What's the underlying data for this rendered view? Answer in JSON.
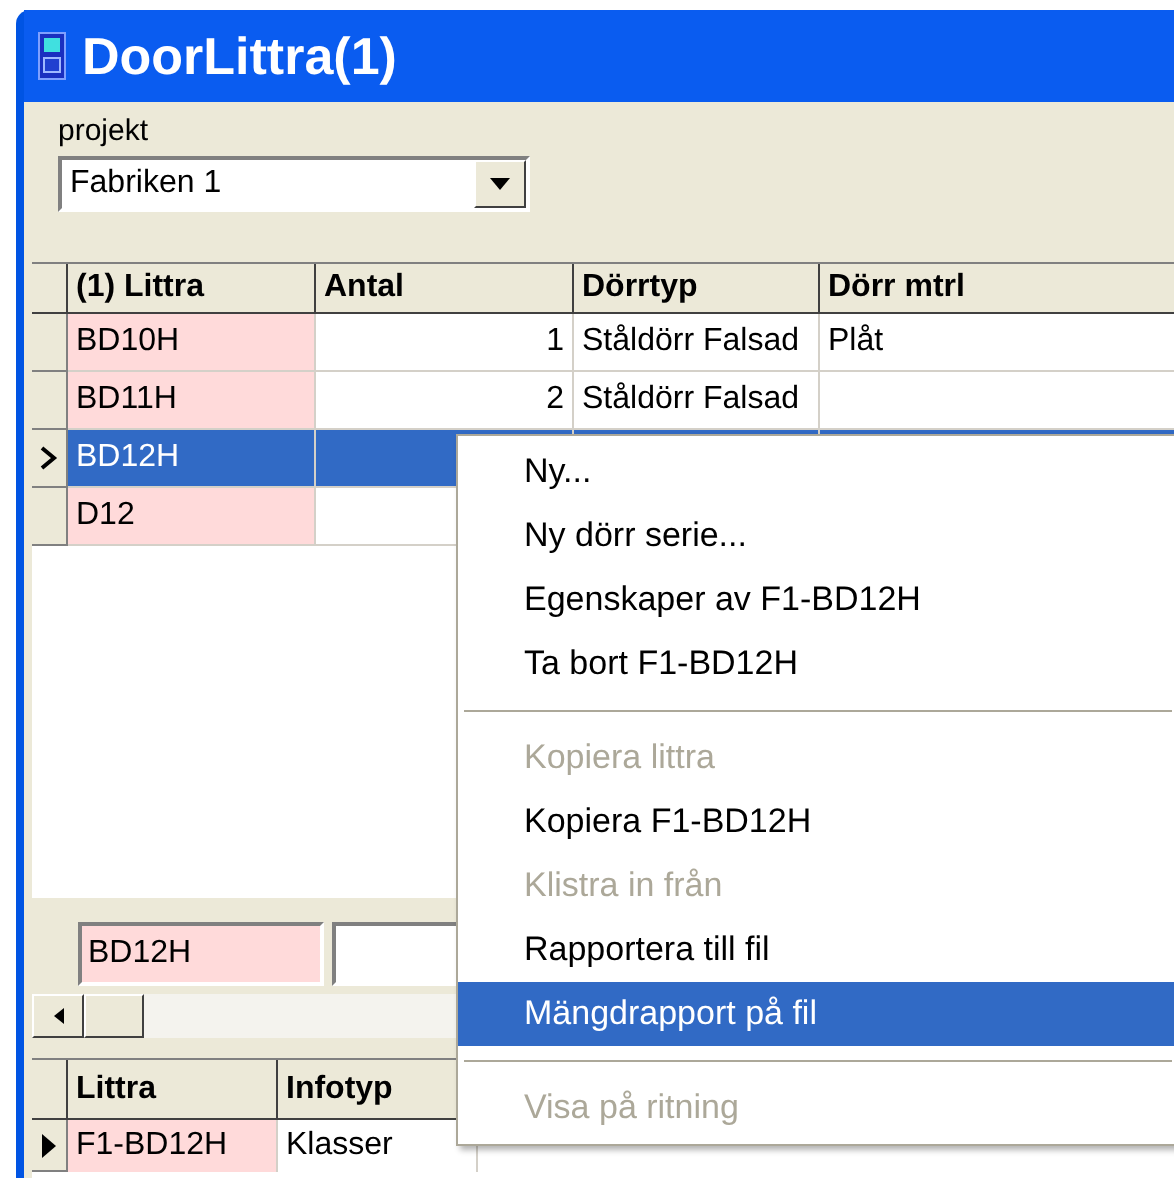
{
  "window": {
    "title": "DoorLittra(1)"
  },
  "project": {
    "label": "projekt",
    "value": "Fabriken 1"
  },
  "grid": {
    "columns": [
      "(1) Littra",
      "Antal",
      "Dörrtyp",
      "Dörr mtrl"
    ],
    "rows": [
      {
        "littra": "BD10H",
        "antal": "1",
        "dorrtyp": "Ståldörr Falsad",
        "dorr_mtrl": "Plåt",
        "selected": false
      },
      {
        "littra": "BD11H",
        "antal": "2",
        "dorrtyp": "Ståldörr Falsad",
        "selected": false
      },
      {
        "littra": "BD12H",
        "selected": true
      },
      {
        "littra": "D12",
        "selected": false
      }
    ]
  },
  "edit_fields": [
    {
      "value": "BD12H",
      "kind": "littra"
    },
    {
      "kind": "plain"
    }
  ],
  "bottom_grid": {
    "columns": [
      "Littra",
      "Infotyp"
    ],
    "rows": [
      {
        "littra": "F1-BD12H",
        "infotyp": "Klasser",
        "selected": true
      }
    ]
  },
  "context_menu": [
    {
      "kind": "item",
      "label": "Ny...",
      "disabled": false,
      "selected": false
    },
    {
      "kind": "item",
      "label": "Ny dörr serie...",
      "disabled": false,
      "selected": false
    },
    {
      "kind": "item",
      "label": "Egenskaper av F1-BD12H",
      "disabled": false,
      "selected": false
    },
    {
      "kind": "item",
      "label": "Ta bort F1-BD12H",
      "disabled": false,
      "selected": false
    },
    {
      "kind": "separator"
    },
    {
      "kind": "item",
      "label": "Kopiera littra",
      "disabled": true,
      "selected": false
    },
    {
      "kind": "item",
      "label": "Kopiera F1-BD12H",
      "disabled": false,
      "selected": false
    },
    {
      "kind": "item",
      "label": "Klistra in från",
      "disabled": true,
      "selected": false
    },
    {
      "kind": "item",
      "label": "Rapportera till fil",
      "disabled": false,
      "selected": false
    },
    {
      "kind": "item",
      "label": "Mängdrapport på fil",
      "disabled": false,
      "selected": true
    },
    {
      "kind": "separator"
    },
    {
      "kind": "item",
      "label": "Visa på ritning",
      "disabled": true,
      "selected": false
    }
  ]
}
